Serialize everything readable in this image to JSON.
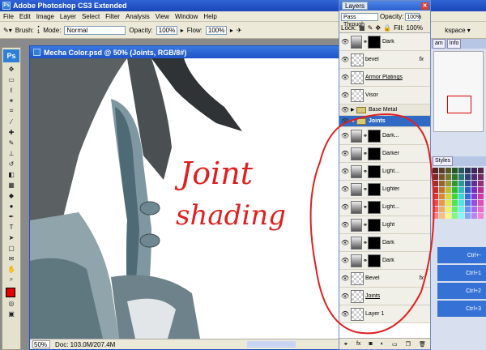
{
  "app": {
    "title": "Adobe Photoshop CS3 Extended",
    "menu": [
      "File",
      "Edit",
      "Image",
      "Layer",
      "Select",
      "Filter",
      "Analysis",
      "View",
      "Window",
      "Help"
    ],
    "workspace_label": "kspace ▾"
  },
  "options": {
    "brush_label": "Brush:",
    "brush_size": "1",
    "mode_label": "Mode:",
    "mode_value": "Normal",
    "opacity_label": "Opacity:",
    "opacity_value": "100%",
    "flow_label": "Flow:",
    "flow_value": "100%"
  },
  "document": {
    "title": "Mecha Color.psd @ 50% (Joints, RGB/8#)",
    "zoom": "50%",
    "doc_info": "Doc: 103.0M/207.4M",
    "annotation_line1": "Joint",
    "annotation_line2": "shading"
  },
  "layers_panel": {
    "tab": "Layers",
    "blend_mode": "Pass Through",
    "opacity_label": "Opacity:",
    "opacity_value": "100%",
    "lock_label": "Lock:",
    "fill_label": "Fill:",
    "fill_value": "100%",
    "rows": [
      {
        "type": "adj",
        "name": "Dark",
        "fx": ""
      },
      {
        "type": "layer",
        "name": "bevel",
        "fx": "fx"
      },
      {
        "type": "layer",
        "name": "Armor Platings",
        "fx": "",
        "underline": true
      },
      {
        "type": "layer",
        "name": "Visor",
        "fx": ""
      },
      {
        "type": "group",
        "name": "Base Metal",
        "selected": false
      },
      {
        "type": "group",
        "name": "Joints",
        "selected": true
      },
      {
        "type": "adj",
        "name": "Dark...",
        "fx": ""
      },
      {
        "type": "adj",
        "name": "Darker",
        "fx": ""
      },
      {
        "type": "adj",
        "name": "Light...",
        "fx": ""
      },
      {
        "type": "adj",
        "name": "Lighter",
        "fx": ""
      },
      {
        "type": "adj",
        "name": "Light...",
        "fx": ""
      },
      {
        "type": "adj",
        "name": "Light",
        "fx": ""
      },
      {
        "type": "adj",
        "name": "Dark",
        "fx": ""
      },
      {
        "type": "adj",
        "name": "Dark",
        "fx": ""
      },
      {
        "type": "layer",
        "name": "Bevel",
        "fx": "fx"
      },
      {
        "type": "layer",
        "name": "Joints",
        "fx": "",
        "underline": true
      },
      {
        "type": "layer",
        "name": "Layer 1",
        "fx": ""
      }
    ]
  },
  "right_dock": {
    "nav_tabs": [
      "am",
      "Info"
    ],
    "swatch_tabs": [
      "Styles"
    ],
    "actions": [
      "Ctrl+-",
      "Ctrl+1",
      "Ctrl+2",
      "Ctrl+3"
    ]
  },
  "colors": {
    "foreground": "#e00000",
    "selection": "#316ac5",
    "annotation": "#e02020"
  }
}
